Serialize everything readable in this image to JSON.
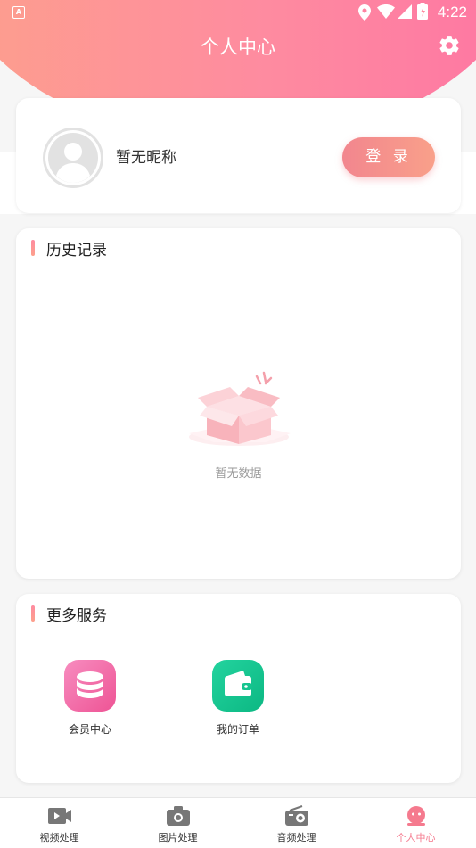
{
  "status_bar": {
    "time": "4:22",
    "notification_icon": "A"
  },
  "header": {
    "title": "个人中心",
    "settings_icon": "gear-icon"
  },
  "profile": {
    "nickname": "暂无昵称",
    "login_label": "登 录",
    "avatar_icon": "user-avatar-icon"
  },
  "history": {
    "title": "历史记录",
    "empty_text": "暂无数据"
  },
  "services": {
    "title": "更多服务",
    "items": [
      {
        "label": "会员中心",
        "icon": "database-icon",
        "color": "#f0609c"
      },
      {
        "label": "我的订单",
        "icon": "wallet-icon",
        "color": "#13c38f"
      }
    ]
  },
  "tabbar": {
    "items": [
      {
        "label": "视频处理",
        "icon": "video-camera-icon"
      },
      {
        "label": "图片处理",
        "icon": "camera-icon"
      },
      {
        "label": "音频处理",
        "icon": "radio-icon"
      },
      {
        "label": "个人中心",
        "icon": "user-face-icon",
        "active": true
      }
    ],
    "active_color": "#f57a8e"
  },
  "colors": {
    "accent": "#fe8ba0",
    "login_start": "#f2868e",
    "login_end": "#f9a08a"
  }
}
